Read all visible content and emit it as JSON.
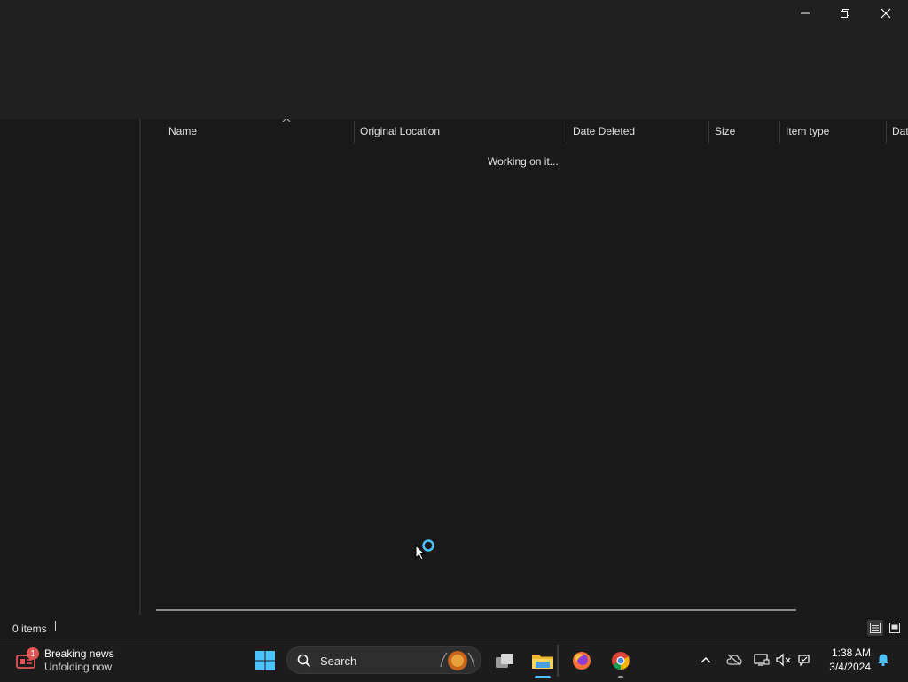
{
  "window": {
    "controls": {
      "minimize_icon": "minimize-icon",
      "maximize_icon": "restore-icon",
      "close_icon": "close-icon"
    }
  },
  "columns": [
    {
      "label": "Name"
    },
    {
      "label": "Original Location"
    },
    {
      "label": "Date Deleted"
    },
    {
      "label": "Size"
    },
    {
      "label": "Item type"
    },
    {
      "label": "Dat"
    }
  ],
  "content": {
    "loading_text": "Working on it..."
  },
  "status": {
    "item_count": "0 items"
  },
  "taskbar": {
    "news": {
      "badge": "1",
      "title": "Breaking news",
      "subtitle": "Unfolding now"
    },
    "search_label": "Search",
    "clock": {
      "time": "1:38 AM",
      "date": "3/4/2024"
    }
  },
  "colors": {
    "background": "#191919",
    "accent": "#4cc2ff",
    "badge": "#e05454"
  }
}
